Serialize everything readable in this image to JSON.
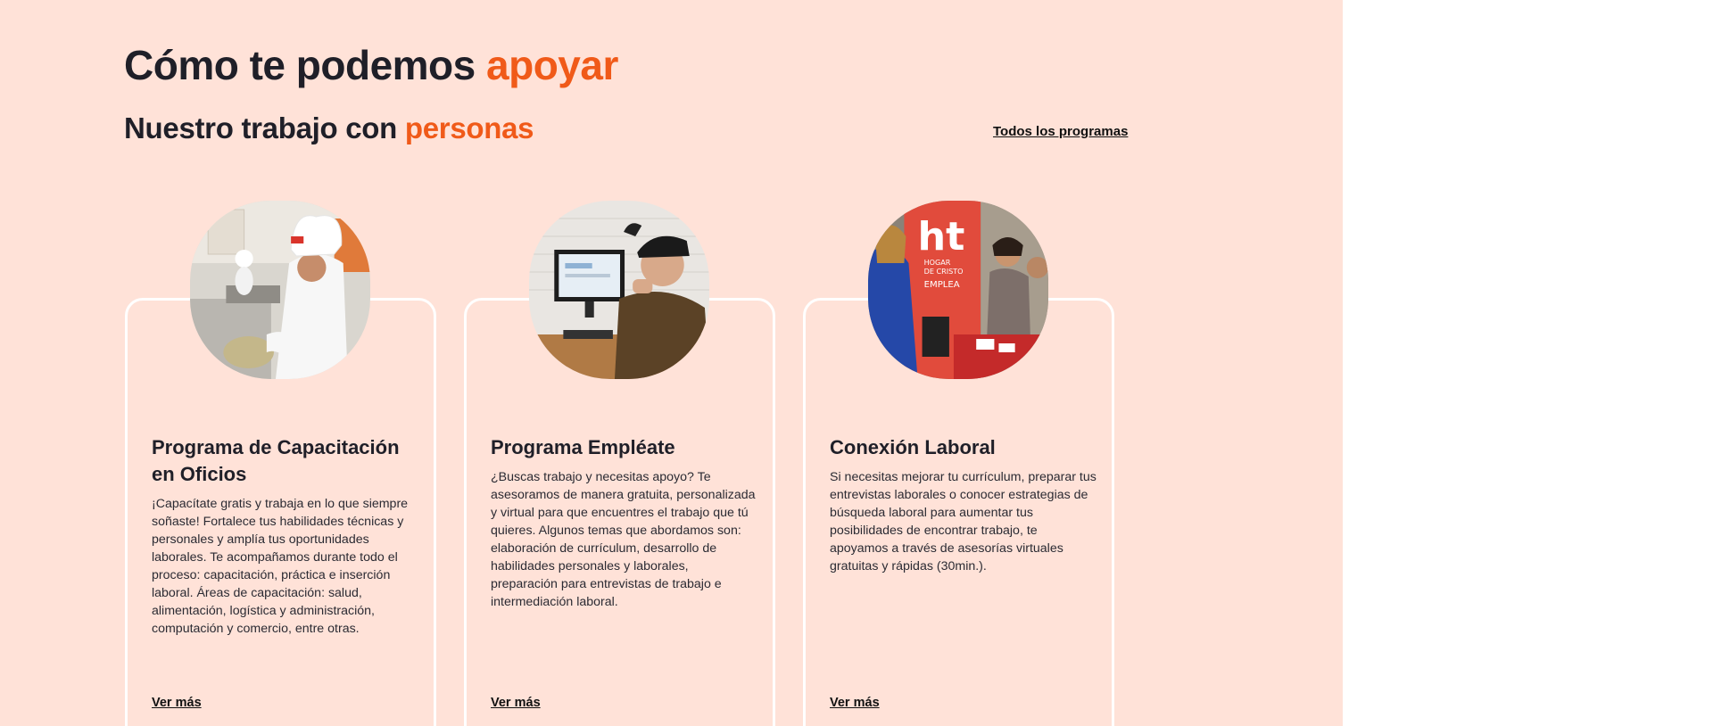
{
  "section": {
    "heading": {
      "prefix": "Cómo te podemos ",
      "accent": "apoyar"
    },
    "subheading": {
      "prefix": "Nuestro trabajo con ",
      "accent": "personas"
    },
    "all_programs_link": "Todos los programas"
  },
  "cards": [
    {
      "title": "Programa de Capacitación en Oficios",
      "text": "¡Capacítate gratis y trabaja en lo que siempre soñaste! Fortalece tus habilidades técnicas y personales y amplía tus oportunidades laborales. Te acompañamos durante todo el proceso: capacitación, práctica e inserción laboral. Áreas de capacitación: salud, alimentación, logística y administración, computación y comercio, entre otras.",
      "link": "Ver más",
      "image": "chef-trainee-photo"
    },
    {
      "title": "Programa Empléate",
      "text": "¿Buscas trabajo y necesitas apoyo? Te asesoramos de manera gratuita, personalizada y virtual para que encuentres el trabajo que tú quieres. Algunos temas que abordamos son: elaboración de currículum, desarrollo de habilidades personales y laborales, preparación para entrevistas de trabajo e intermediación laboral.",
      "link": "Ver más",
      "image": "man-at-computer-photo"
    },
    {
      "title": "Conexión Laboral",
      "text": "Si necesitas mejorar tu currículum, preparar tus entrevistas laborales o conocer estrategias de búsqueda laboral para aumentar tus posibilidades de encontrar trabajo, te apoyamos a través de asesorías virtuales gratuitas y rápidas (30min.).",
      "link": "Ver más",
      "image": "job-fair-photo",
      "banner_lines": [
        "ht",
        "HOGAR",
        "DE CRISTO",
        "EMPLEA"
      ]
    }
  ],
  "colors": {
    "background": "#ffe2d8",
    "accent": "#f05a19",
    "text": "#1f1f28"
  }
}
